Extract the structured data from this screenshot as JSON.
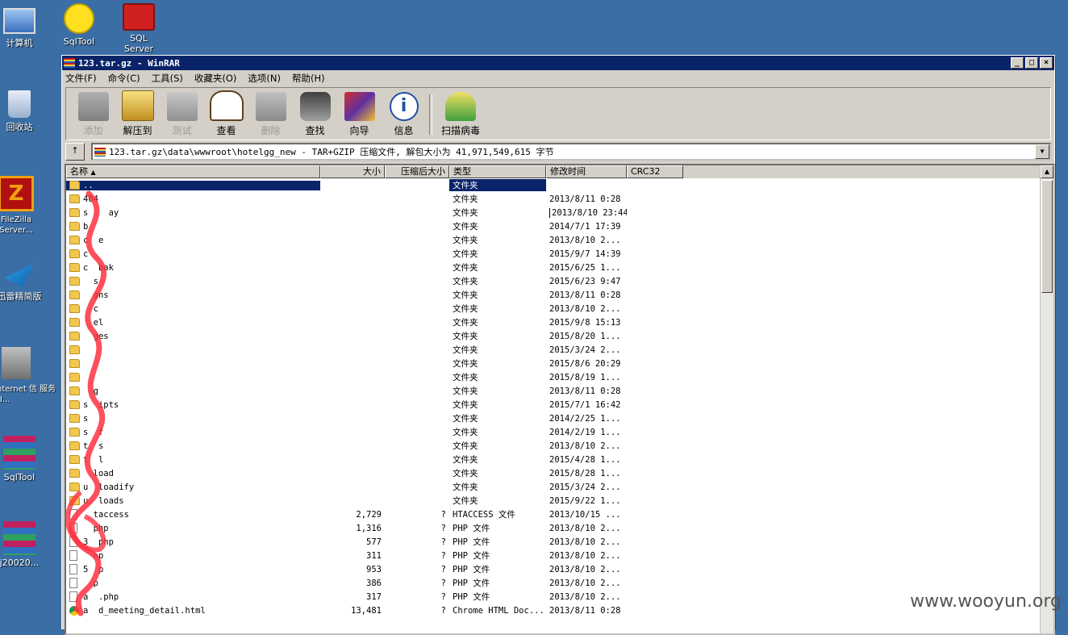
{
  "desktop": {
    "icons": [
      {
        "label": "计算机",
        "icon": "computer-icon"
      },
      {
        "label": "SqlTool",
        "icon": "smiley-icon"
      },
      {
        "label": "SQL Server",
        "icon": "toolbox-icon"
      },
      {
        "label": "回收站",
        "icon": "recycle-bin-icon"
      },
      {
        "label": "FileZilla Server...",
        "icon": "filezilla-icon"
      },
      {
        "label": "迅雷精简版",
        "icon": "thunder-icon"
      },
      {
        "label": "nternet 信 服务 (I...",
        "icon": "iis-icon"
      },
      {
        "label": "SqlTool",
        "icon": "winrar-icon"
      },
      {
        "label": "j20020...",
        "icon": "winrar-icon"
      }
    ]
  },
  "window": {
    "title": "123.tar.gz - WinRAR",
    "controls": {
      "minimize": "_",
      "maximize": "□",
      "close": "×"
    }
  },
  "menu": [
    "文件(F)",
    "命令(C)",
    "工具(S)",
    "收藏夹(O)",
    "选项(N)",
    "帮助(H)"
  ],
  "toolbar": [
    {
      "label": "添加",
      "icon": "add-archive-icon",
      "enabled": false
    },
    {
      "label": "解压到",
      "icon": "extract-to-icon",
      "enabled": true
    },
    {
      "label": "测试",
      "icon": "test-icon",
      "enabled": false
    },
    {
      "label": "查看",
      "icon": "view-icon",
      "enabled": true
    },
    {
      "label": "删除",
      "icon": "delete-icon",
      "enabled": false
    },
    {
      "label": "查找",
      "icon": "find-icon",
      "enabled": true
    },
    {
      "label": "向导",
      "icon": "wizard-icon",
      "enabled": true
    },
    {
      "label": "信息",
      "icon": "info-icon",
      "enabled": true
    },
    {
      "label": "扫描病毒",
      "icon": "virus-scan-icon",
      "enabled": true
    }
  ],
  "address": {
    "up_label": "↑",
    "path": "123.tar.gz\\data\\wwwroot\\hotelgg_new - TAR+GZIP 压缩文件, 解包大小为 41,971,549,615 字节"
  },
  "columns": {
    "name": "名称",
    "size": "大小",
    "packed": "压缩后大小",
    "type": "类型",
    "modified": "修改时间",
    "crc": "CRC32"
  },
  "rows": [
    {
      "name": "..",
      "size": "",
      "packed": "",
      "type": "文件夹",
      "modified": "",
      "kind": "folder",
      "selected": true
    },
    {
      "name": "404",
      "size": "",
      "packed": "",
      "type": "文件夹",
      "modified": "2013/8/11 0:28",
      "kind": "folder"
    },
    {
      "name": "s    ay",
      "size": "",
      "packed": "",
      "type": "文件夹",
      "modified": "2013/8/10 23:44",
      "kind": "folder",
      "boxed": true
    },
    {
      "name": "b",
      "size": "",
      "packed": "",
      "type": "文件夹",
      "modified": "2014/7/1 17:39",
      "kind": "folder"
    },
    {
      "name": "c  e",
      "size": "",
      "packed": "",
      "type": "文件夹",
      "modified": "2013/8/10 2...",
      "kind": "folder"
    },
    {
      "name": "c",
      "size": "",
      "packed": "",
      "type": "文件夹",
      "modified": "2015/9/7 14:39",
      "kind": "folder"
    },
    {
      "name": "c  bak",
      "size": "",
      "packed": "",
      "type": "文件夹",
      "modified": "2015/6/25 1...",
      "kind": "folder"
    },
    {
      "name": "  s",
      "size": "",
      "packed": "",
      "type": "文件夹",
      "modified": "2015/6/23 9:47",
      "kind": "folder"
    },
    {
      "name": "  gns",
      "size": "",
      "packed": "",
      "type": "文件夹",
      "modified": "2013/8/11 0:28",
      "kind": "folder"
    },
    {
      "name": "  c",
      "size": "",
      "packed": "",
      "type": "文件夹",
      "modified": "2013/8/10 2...",
      "kind": "folder"
    },
    {
      "name": "  el",
      "size": "",
      "packed": "",
      "type": "文件夹",
      "modified": "2015/9/8 15:13",
      "kind": "folder"
    },
    {
      "name": "  ges",
      "size": "",
      "packed": "",
      "type": "文件夹",
      "modified": "2015/8/20 1...",
      "kind": "folder"
    },
    {
      "name": "",
      "size": "",
      "packed": "",
      "type": "文件夹",
      "modified": "2015/3/24 2...",
      "kind": "folder"
    },
    {
      "name": "",
      "size": "",
      "packed": "",
      "type": "文件夹",
      "modified": "2015/8/6 20:29",
      "kind": "folder"
    },
    {
      "name": "",
      "size": "",
      "packed": "",
      "type": "文件夹",
      "modified": "2015/8/19 1...",
      "kind": "folder"
    },
    {
      "name": "  g",
      "size": "",
      "packed": "",
      "type": "文件夹",
      "modified": "2013/8/11 0:28",
      "kind": "folder"
    },
    {
      "name": "s  ipts",
      "size": "",
      "packed": "",
      "type": "文件夹",
      "modified": "2015/7/1 16:42",
      "kind": "folder"
    },
    {
      "name": "s",
      "size": "",
      "packed": "",
      "type": "文件夹",
      "modified": "2014/2/25 1...",
      "kind": "folder"
    },
    {
      "name": "s  f",
      "size": "",
      "packed": "",
      "type": "文件夹",
      "modified": "2014/2/19 1...",
      "kind": "folder"
    },
    {
      "name": "t  s",
      "size": "",
      "packed": "",
      "type": "文件夹",
      "modified": "2013/8/10 2...",
      "kind": "folder"
    },
    {
      "name": "t  l",
      "size": "",
      "packed": "",
      "type": "文件夹",
      "modified": "2015/4/28 1...",
      "kind": "folder"
    },
    {
      "name": "  load",
      "size": "",
      "packed": "",
      "type": "文件夹",
      "modified": "2015/8/28 1...",
      "kind": "folder"
    },
    {
      "name": "u  loadify",
      "size": "",
      "packed": "",
      "type": "文件夹",
      "modified": "2015/3/24 2...",
      "kind": "folder"
    },
    {
      "name": "u  loads",
      "size": "",
      "packed": "",
      "type": "文件夹",
      "modified": "2015/9/22 1...",
      "kind": "folder"
    },
    {
      "name": "  taccess",
      "size": "2,729",
      "packed": "?",
      "type": "HTACCESS 文件",
      "modified": "2013/10/15 ...",
      "kind": "file"
    },
    {
      "name": "  php",
      "size": "1,316",
      "packed": "?",
      "type": "PHP 文件",
      "modified": "2013/8/10 2...",
      "kind": "file"
    },
    {
      "name": "3  php",
      "size": "577",
      "packed": "?",
      "type": "PHP 文件",
      "modified": "2013/8/10 2...",
      "kind": "file"
    },
    {
      "name": "  hp",
      "size": "311",
      "packed": "?",
      "type": "PHP 文件",
      "modified": "2013/8/10 2...",
      "kind": "file"
    },
    {
      "name": "5  p",
      "size": "953",
      "packed": "?",
      "type": "PHP 文件",
      "modified": "2013/8/10 2...",
      "kind": "file"
    },
    {
      "name": "  p",
      "size": "386",
      "packed": "?",
      "type": "PHP 文件",
      "modified": "2013/8/10 2...",
      "kind": "file"
    },
    {
      "name": "a  .php",
      "size": "317",
      "packed": "?",
      "type": "PHP 文件",
      "modified": "2013/8/10 2...",
      "kind": "file"
    },
    {
      "name": "a  d_meeting_detail.html",
      "size": "13,481",
      "packed": "?",
      "type": "Chrome HTML Doc...",
      "modified": "2013/8/11 0:28",
      "kind": "chrome"
    }
  ],
  "watermark": "www.wooyun.org",
  "colors": {
    "desktop": "#3a6ea5",
    "titlebar": "#0a246a",
    "selection": "#0a246a",
    "scribble": "#ff3040"
  }
}
